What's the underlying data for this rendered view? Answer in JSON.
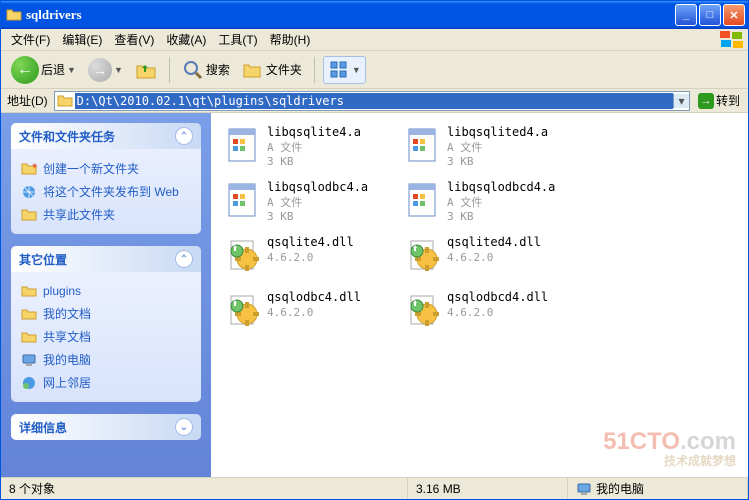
{
  "titlebar": {
    "title": "sqldrivers"
  },
  "menu": {
    "file": "文件(F)",
    "edit": "编辑(E)",
    "view": "查看(V)",
    "favorites": "收藏(A)",
    "tools": "工具(T)",
    "help": "帮助(H)"
  },
  "toolbar": {
    "back": "后退",
    "search": "搜索",
    "folders": "文件夹"
  },
  "address": {
    "label": "地址(D)",
    "value": "D:\\Qt\\2010.02.1\\qt\\plugins\\sqldrivers",
    "go": "转到"
  },
  "sidebar": {
    "tasks_title": "文件和文件夹任务",
    "tasks": [
      "创建一个新文件夹",
      "将这个文件夹发布到 Web",
      "共享此文件夹"
    ],
    "places_title": "其它位置",
    "places": [
      "plugins",
      "我的文档",
      "共享文档",
      "我的电脑",
      "网上邻居"
    ],
    "details_title": "详细信息"
  },
  "files": [
    {
      "name": "libqsqlite4.a",
      "type": "A 文件",
      "size": "3 KB",
      "icon": "archive"
    },
    {
      "name": "libqsqlited4.a",
      "type": "A 文件",
      "size": "3 KB",
      "icon": "archive"
    },
    {
      "name": "libqsqlodbc4.a",
      "type": "A 文件",
      "size": "3 KB",
      "icon": "archive"
    },
    {
      "name": "libqsqlodbcd4.a",
      "type": "A 文件",
      "size": "3 KB",
      "icon": "archive"
    },
    {
      "name": "qsqlite4.dll",
      "type": "4.6.2.0",
      "size": "",
      "icon": "dll"
    },
    {
      "name": "qsqlited4.dll",
      "type": "4.6.2.0",
      "size": "",
      "icon": "dll"
    },
    {
      "name": "qsqlodbc4.dll",
      "type": "4.6.2.0",
      "size": "",
      "icon": "dll"
    },
    {
      "name": "qsqlodbcd4.dll",
      "type": "4.6.2.0",
      "size": "",
      "icon": "dll"
    }
  ],
  "status": {
    "objects": "8 个对象",
    "size": "3.16 MB",
    "location": "我的电脑"
  },
  "watermark": {
    "main": "51CTO",
    "suffix": ".com",
    "tag": "技术成就梦想"
  }
}
